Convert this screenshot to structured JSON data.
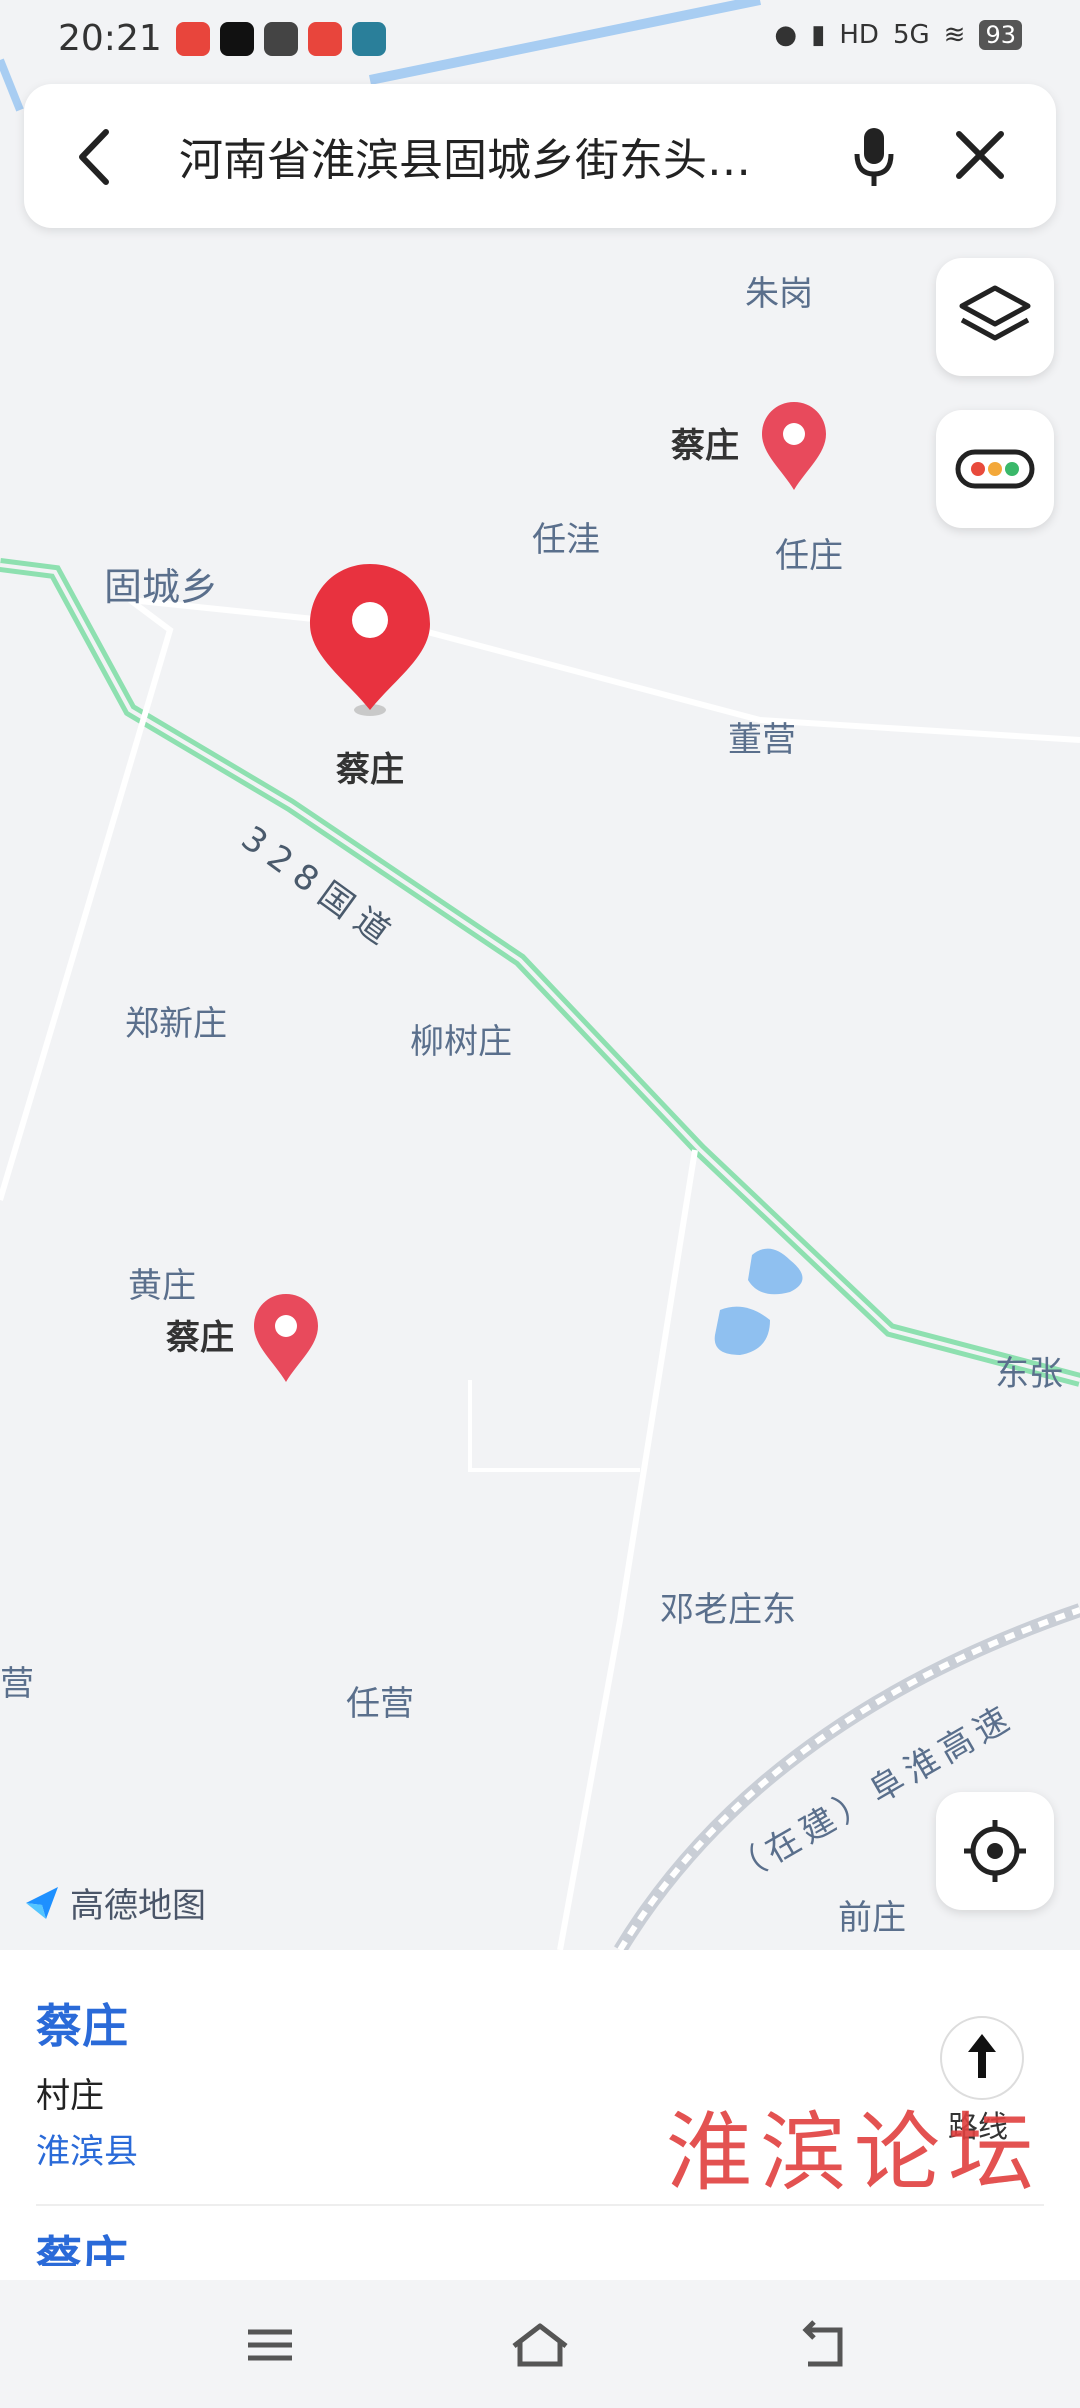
{
  "status_bar": {
    "time": "20:21",
    "network": "5G",
    "hd": "HD",
    "battery": "93"
  },
  "search": {
    "query": "河南省淮滨县固城乡街东头…",
    "back_icon": "back-arrow-icon",
    "mic_icon": "microphone-icon",
    "close_icon": "close-icon"
  },
  "map": {
    "labels": {
      "zhugang": "朱岗",
      "renwa": "任洼",
      "renzhuang": "任庄",
      "guchengxiang": "固城乡",
      "dongying": "董营",
      "road328": "328国道",
      "zhengxinzhuang": "郑新庄",
      "liushuzhuang": "柳树庄",
      "huangzhuang": "黄庄",
      "dongzhang": "东张",
      "denglaozhuangdong": "邓老庄东",
      "renying": "任营",
      "ying": "营",
      "expressway": "（在建）阜淮高速",
      "qianzhuang": "前庄"
    },
    "pins": {
      "main": "蔡庄",
      "top": "蔡庄",
      "left": "蔡庄"
    },
    "logo_text": "高德地图",
    "colors": {
      "pin_red": "#e8323f",
      "road_green": "#8ee0b0",
      "water": "#8fc0f0"
    }
  },
  "result": {
    "name": "蔡庄",
    "type": "村庄",
    "region": "淮滨县",
    "route_label": "路线",
    "next_name": "蔡庄",
    "watermark": "淮滨论坛"
  }
}
